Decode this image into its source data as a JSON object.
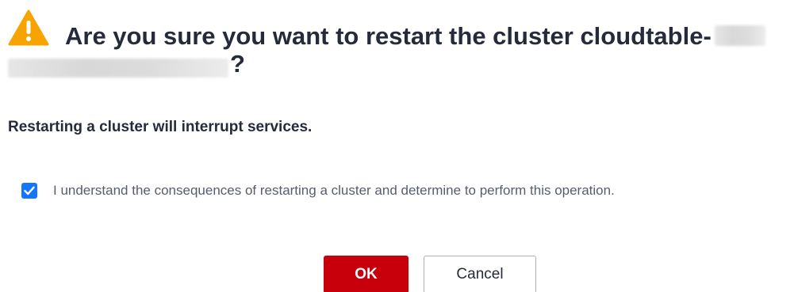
{
  "dialog": {
    "title_prefix": "Are you sure you want to restart the cluster cloudtable-",
    "title_suffix": "?",
    "warning": "Restarting a cluster will interrupt services.",
    "confirm_checked": true,
    "confirm_label": "I understand the consequences of restarting a cluster and determine to perform this operation.",
    "ok_label": "OK",
    "cancel_label": "Cancel"
  },
  "icons": {
    "warning": "warning-triangle-icon",
    "check": "checkmark-icon"
  },
  "colors": {
    "warning_icon": "#f7a400",
    "primary_button": "#c7000b",
    "checkbox": "#1476ff",
    "text": "#252b3a"
  }
}
